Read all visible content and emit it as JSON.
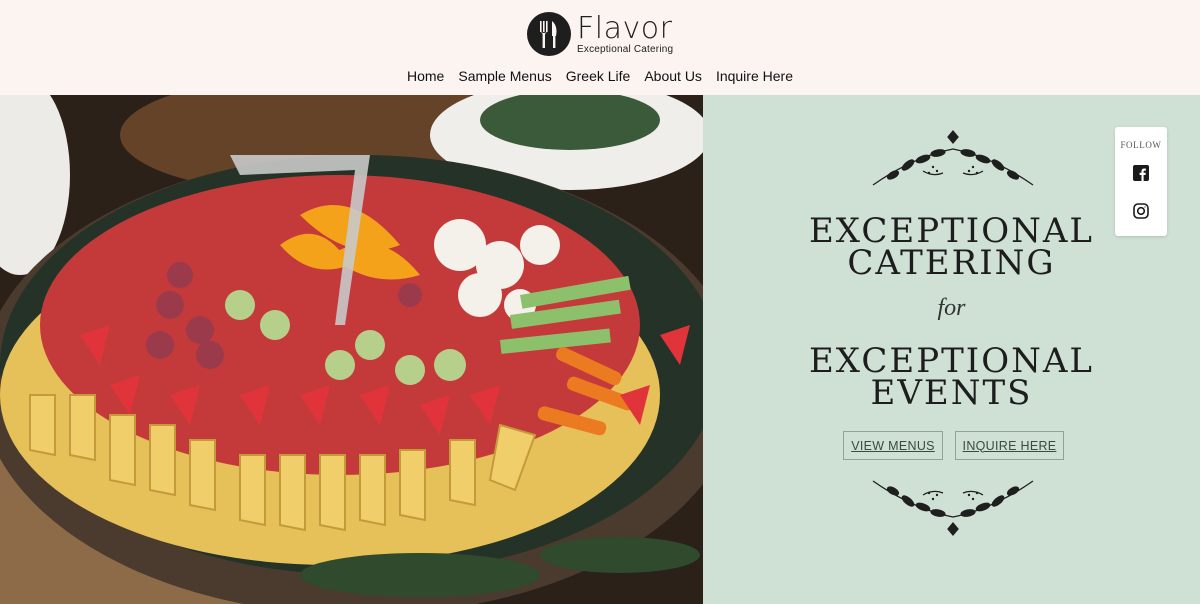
{
  "brand": {
    "name": "Flavor",
    "tagline": "Exceptional Catering"
  },
  "nav": {
    "items": [
      {
        "label": "Home"
      },
      {
        "label": "Sample Menus"
      },
      {
        "label": "Greek Life"
      },
      {
        "label": "About Us"
      },
      {
        "label": "Inquire Here"
      }
    ]
  },
  "hero": {
    "headline_line1": "EXCEPTIONAL",
    "headline_line2": "CATERING",
    "connector": "for",
    "headline_line3": "EXCEPTIONAL",
    "headline_line4": "EVENTS",
    "buttons": {
      "view_menus": "VIEW MENUS",
      "inquire_here": "INQUIRE HERE"
    },
    "panel_color": "#cfe1d5"
  },
  "follow": {
    "label": "FOLLOW",
    "icons": [
      "facebook-icon",
      "instagram-icon"
    ]
  },
  "colors": {
    "header_bg": "#fbf4f1",
    "text": "#1d1d1d",
    "button_border": "#8da694"
  }
}
